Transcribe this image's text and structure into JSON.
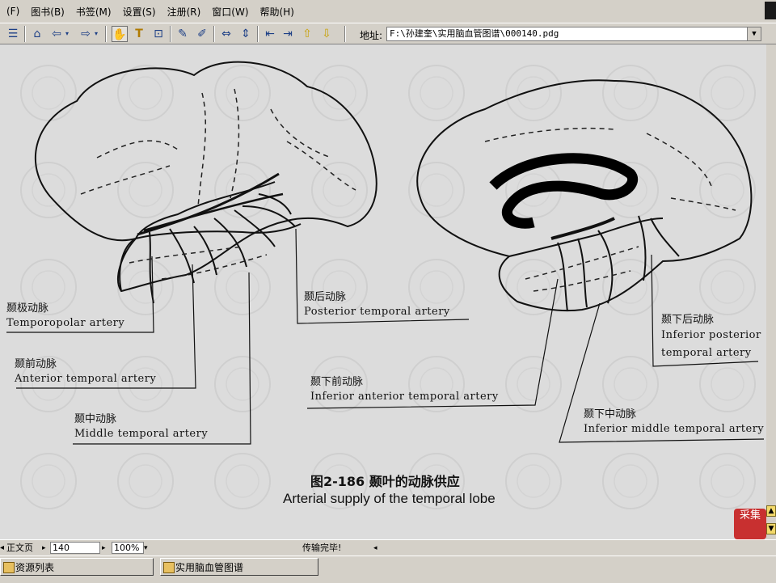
{
  "menubar": {
    "items": [
      "(F)",
      "图书(B)",
      "书签(M)",
      "设置(S)",
      "注册(R)",
      "窗口(W)",
      "帮助(H)"
    ]
  },
  "toolbar": {
    "address_label": "地址:",
    "address_value": "F:\\孙建奎\\实用脑血管图谱\\000140.pdg"
  },
  "figure": {
    "caption_cn": "图2-186   颞叶的动脉供应",
    "caption_en": "Arterial supply of the temporal lobe",
    "labels": [
      {
        "cn": "颞极动脉",
        "en": "Temporopolar artery"
      },
      {
        "cn": "颞前动脉",
        "en": "Anterior temporal artery"
      },
      {
        "cn": "颞中动脉",
        "en": "Middle temporal artery"
      },
      {
        "cn": "颞后动脉",
        "en": "Posterior temporal artery"
      },
      {
        "cn": "颞下前动脉",
        "en": "Inferior anterior temporal artery"
      },
      {
        "cn": "颞下中动脉",
        "en": "Inferior middle temporal artery"
      },
      {
        "cn": "颞下后动脉",
        "en": "Inferior posterior",
        "en2": "temporal artery"
      }
    ],
    "badge_text": "采集"
  },
  "statusbar": {
    "page_label": "正文页",
    "page_number": "140",
    "zoom": "100%",
    "message": "传输完毕!"
  },
  "taskbar": {
    "left_label": "资源列表",
    "window_label": "实用脑血管图谱"
  }
}
